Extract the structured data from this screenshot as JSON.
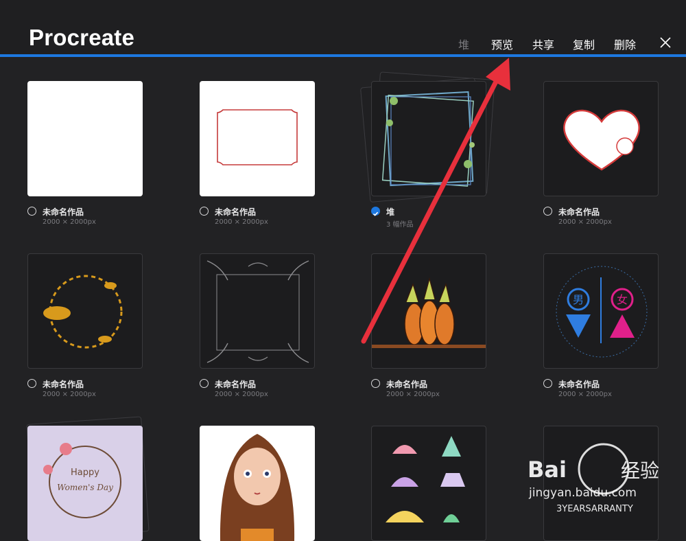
{
  "header": {
    "app_title": "Procreate",
    "actions": [
      "堆",
      "预览",
      "共享",
      "复制",
      "删除"
    ],
    "close_icon": "close-icon",
    "accent_color": "#1d78e0"
  },
  "gallery": {
    "items": [
      {
        "name": "未命名作品",
        "size": "2000 × 2000px",
        "selected": false
      },
      {
        "name": "未命名作品",
        "size": "2000 × 2000px",
        "selected": false
      },
      {
        "name": "堆",
        "size": "3 幅作品",
        "selected": true
      },
      {
        "name": "未命名作品",
        "size": "2000 × 2000px",
        "selected": false
      },
      {
        "name": "未命名作品",
        "size": "2000 × 2000px",
        "selected": false
      },
      {
        "name": "未命名作品",
        "size": "2000 × 2000px",
        "selected": false
      },
      {
        "name": "未命名作品",
        "size": "2000 × 2000px",
        "selected": false
      },
      {
        "name": "未命名作品",
        "size": "2000 × 2000px",
        "selected": false
      }
    ],
    "artwork_text": {
      "male_char": "男",
      "female_char": "女",
      "card_text_1": "Happy",
      "card_text_2": "Women's Day"
    }
  },
  "watermark": {
    "brand": "Bai",
    "brand2": "经验",
    "url": "jingyan.baidu.com",
    "tag": "3YEARSARRANTY"
  }
}
